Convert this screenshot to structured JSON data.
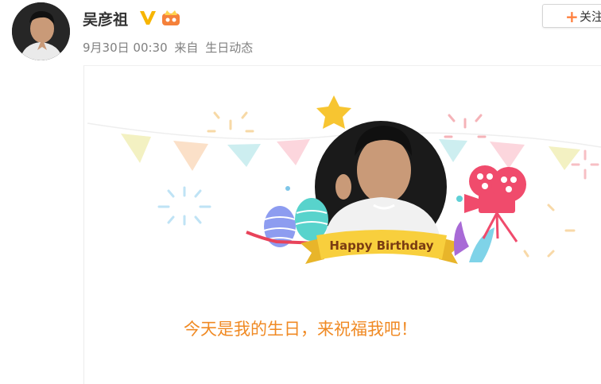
{
  "user": {
    "name": "吴彦祖",
    "verified_icon": "verified-v-icon",
    "vip_icon": "crown-badge-icon"
  },
  "post": {
    "date": "9月30日 00:30",
    "source_prefix": "来自",
    "source": "生日动态"
  },
  "follow_button": {
    "icon": "plus-icon",
    "label": "关注"
  },
  "card": {
    "banner_text": "Happy Birthday",
    "caption": "今天是我的生日，来祝福我吧！"
  },
  "colors": {
    "accent_orange": "#ff8140",
    "caption_orange": "#f08a24",
    "ribbon_yellow": "#f8cf3d",
    "verified_gold": "#f7b500"
  }
}
